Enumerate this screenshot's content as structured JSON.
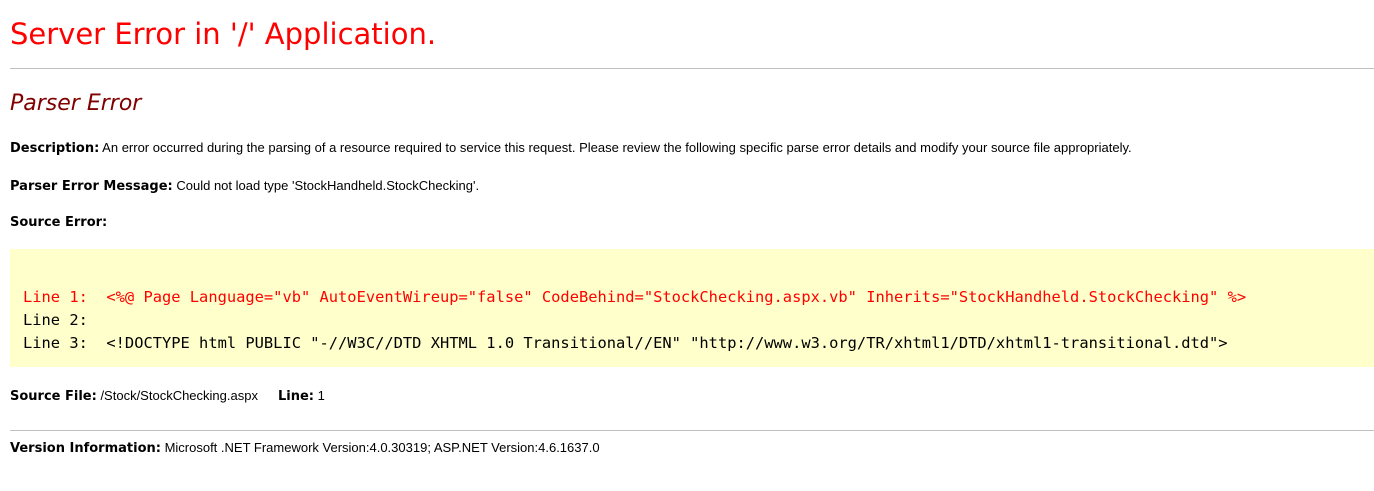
{
  "header": {
    "title": "Server Error in '/' Application."
  },
  "error": {
    "type": "Parser Error",
    "description_label": "Description:",
    "description_text": " An error occurred during the parsing of a resource required to service this request. Please review the following specific parse error details and modify your source file appropriately.",
    "message_label": "Parser Error Message:",
    "message_text": " Could not load type 'StockHandheld.StockChecking'.",
    "source_error_label": "Source Error:"
  },
  "source_code": {
    "lines": [
      "Line 1:  <%@ Page Language=\"vb\" AutoEventWireup=\"false\" CodeBehind=\"StockChecking.aspx.vb\" Inherits=\"StockHandheld.StockChecking\" %>",
      "Line 2:",
      "Line 3:  <!DOCTYPE html PUBLIC \"-//W3C//DTD XHTML 1.0 Transitional//EN\" \"http://www.w3.org/TR/xhtml1/DTD/xhtml1-transitional.dtd\">"
    ]
  },
  "source_file": {
    "file_label": "Source File:",
    "file_value": " /Stock/StockChecking.aspx",
    "line_label": "Line:",
    "line_value": " 1"
  },
  "version": {
    "label": "Version Information:",
    "text": " Microsoft .NET Framework Version:4.0.30319; ASP.NET Version:4.6.1637.0"
  },
  "colors": {
    "title": "#ff0000",
    "error_type": "#800000",
    "code_background": "#ffffcc",
    "error_line": "#ff0000",
    "rule": "#c0c0c0"
  }
}
